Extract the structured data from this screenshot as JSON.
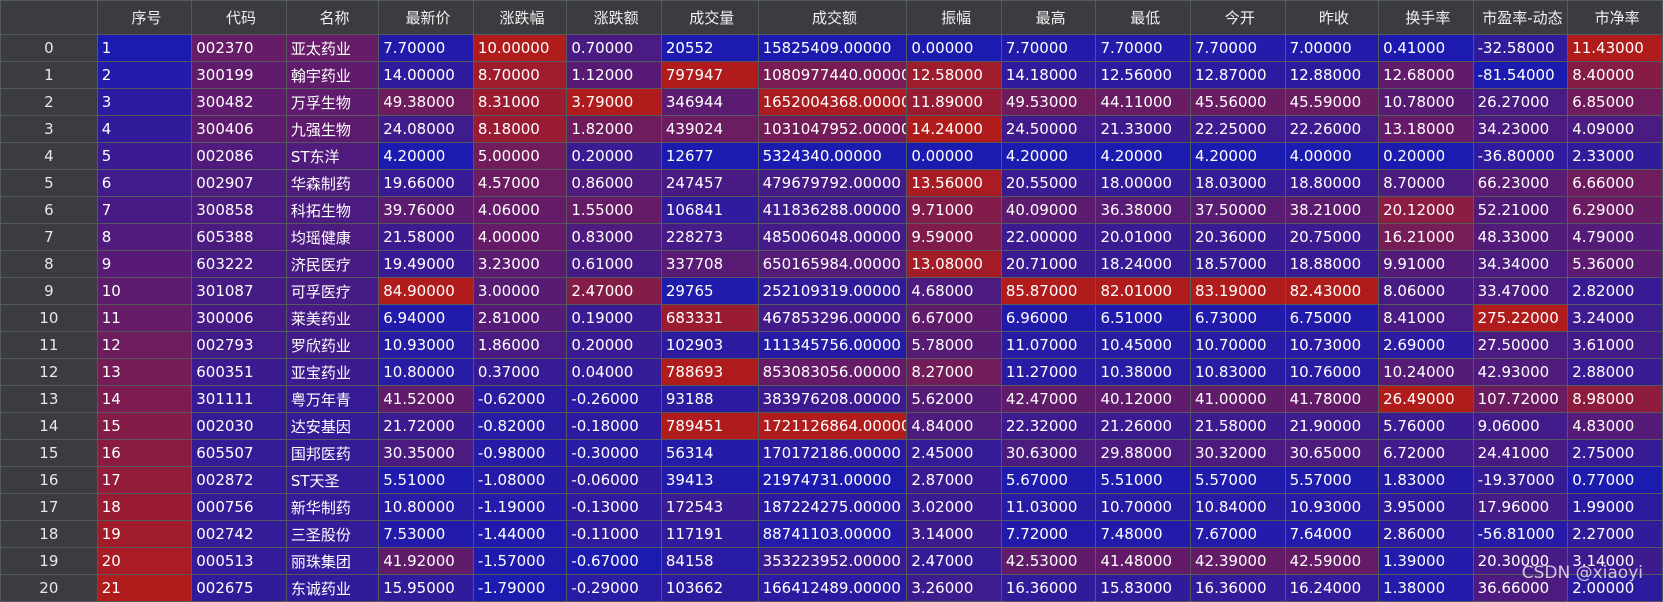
{
  "columns": [
    "",
    "序号",
    "代码",
    "名称",
    "最新价",
    "涨跌幅",
    "涨跌额",
    "成交量",
    "成交额",
    "振幅",
    "最高",
    "最低",
    "今开",
    "昨收",
    "换手率",
    "市盈率-动态",
    "市净率"
  ],
  "rows": [
    [
      "0",
      "1",
      "002370",
      "亚太药业",
      "7.70000",
      "10.00000",
      "0.70000",
      "20552",
      "15825409.00000",
      "0.00000",
      "7.70000",
      "7.70000",
      "7.70000",
      "7.00000",
      "0.41000",
      "-32.58000",
      "11.43000"
    ],
    [
      "1",
      "2",
      "300199",
      "翰宇药业",
      "14.00000",
      "8.70000",
      "1.12000",
      "797947",
      "1080977440.00000",
      "12.58000",
      "14.18000",
      "12.56000",
      "12.87000",
      "12.88000",
      "12.68000",
      "-81.54000",
      "8.40000"
    ],
    [
      "2",
      "3",
      "300482",
      "万孚生物",
      "49.38000",
      "8.31000",
      "3.79000",
      "346944",
      "1652004368.00000",
      "11.89000",
      "49.53000",
      "44.11000",
      "45.56000",
      "45.59000",
      "10.78000",
      "26.27000",
      "6.85000"
    ],
    [
      "3",
      "4",
      "300406",
      "九强生物",
      "24.08000",
      "8.18000",
      "1.82000",
      "439024",
      "1031047952.00000",
      "14.24000",
      "24.50000",
      "21.33000",
      "22.25000",
      "22.26000",
      "13.18000",
      "34.23000",
      "4.09000"
    ],
    [
      "4",
      "5",
      "002086",
      "ST东洋",
      "4.20000",
      "5.00000",
      "0.20000",
      "12677",
      "5324340.00000",
      "0.00000",
      "4.20000",
      "4.20000",
      "4.20000",
      "4.00000",
      "0.20000",
      "-36.80000",
      "2.33000"
    ],
    [
      "5",
      "6",
      "002907",
      "华森制药",
      "19.66000",
      "4.57000",
      "0.86000",
      "247457",
      "479679792.00000",
      "13.56000",
      "20.55000",
      "18.00000",
      "18.03000",
      "18.80000",
      "8.70000",
      "66.23000",
      "6.66000"
    ],
    [
      "6",
      "7",
      "300858",
      "科拓生物",
      "39.76000",
      "4.06000",
      "1.55000",
      "106841",
      "411836288.00000",
      "9.71000",
      "40.09000",
      "36.38000",
      "37.50000",
      "38.21000",
      "20.12000",
      "52.21000",
      "6.29000"
    ],
    [
      "7",
      "8",
      "605388",
      "均瑶健康",
      "21.58000",
      "4.00000",
      "0.83000",
      "228273",
      "485006048.00000",
      "9.59000",
      "22.00000",
      "20.01000",
      "20.36000",
      "20.75000",
      "16.21000",
      "48.33000",
      "4.79000"
    ],
    [
      "8",
      "9",
      "603222",
      "济民医疗",
      "19.49000",
      "3.23000",
      "0.61000",
      "337708",
      "650165984.00000",
      "13.08000",
      "20.71000",
      "18.24000",
      "18.57000",
      "18.88000",
      "9.91000",
      "34.34000",
      "5.36000"
    ],
    [
      "9",
      "10",
      "301087",
      "可孚医疗",
      "84.90000",
      "3.00000",
      "2.47000",
      "29765",
      "252109319.00000",
      "4.68000",
      "85.87000",
      "82.01000",
      "83.19000",
      "82.43000",
      "8.06000",
      "33.47000",
      "2.82000"
    ],
    [
      "10",
      "11",
      "300006",
      "莱美药业",
      "6.94000",
      "2.81000",
      "0.19000",
      "683331",
      "467853296.00000",
      "6.67000",
      "6.96000",
      "6.51000",
      "6.73000",
      "6.75000",
      "8.41000",
      "275.22000",
      "3.24000"
    ],
    [
      "11",
      "12",
      "002793",
      "罗欣药业",
      "10.93000",
      "1.86000",
      "0.20000",
      "102903",
      "111345756.00000",
      "5.78000",
      "11.07000",
      "10.45000",
      "10.70000",
      "10.73000",
      "2.69000",
      "27.50000",
      "3.61000"
    ],
    [
      "12",
      "13",
      "600351",
      "亚宝药业",
      "10.80000",
      "0.37000",
      "0.04000",
      "788693",
      "853083056.00000",
      "8.27000",
      "11.27000",
      "10.38000",
      "10.83000",
      "10.76000",
      "10.24000",
      "42.93000",
      "2.88000"
    ],
    [
      "13",
      "14",
      "301111",
      "粤万年青",
      "41.52000",
      "-0.62000",
      "-0.26000",
      "93188",
      "383976208.00000",
      "5.62000",
      "42.47000",
      "40.12000",
      "41.00000",
      "41.78000",
      "26.49000",
      "107.72000",
      "8.98000"
    ],
    [
      "14",
      "15",
      "002030",
      "达安基因",
      "21.72000",
      "-0.82000",
      "-0.18000",
      "789451",
      "1721126864.00000",
      "4.84000",
      "22.32000",
      "21.26000",
      "21.58000",
      "21.90000",
      "5.76000",
      "9.06000",
      "4.83000"
    ],
    [
      "15",
      "16",
      "605507",
      "国邦医药",
      "30.35000",
      "-0.98000",
      "-0.30000",
      "56314",
      "170172186.00000",
      "2.45000",
      "30.63000",
      "29.88000",
      "30.32000",
      "30.65000",
      "6.72000",
      "24.41000",
      "2.75000"
    ],
    [
      "16",
      "17",
      "002872",
      "ST天圣",
      "5.51000",
      "-1.08000",
      "-0.06000",
      "39413",
      "21974731.00000",
      "2.87000",
      "5.67000",
      "5.51000",
      "5.57000",
      "5.57000",
      "1.83000",
      "-19.37000",
      "0.77000"
    ],
    [
      "17",
      "18",
      "000756",
      "新华制药",
      "10.80000",
      "-1.19000",
      "-0.13000",
      "172543",
      "187224275.00000",
      "3.02000",
      "11.03000",
      "10.70000",
      "10.84000",
      "10.93000",
      "3.95000",
      "17.96000",
      "1.99000"
    ],
    [
      "18",
      "19",
      "002742",
      "三圣股份",
      "7.53000",
      "-1.44000",
      "-0.11000",
      "117191",
      "88741103.00000",
      "3.14000",
      "7.72000",
      "7.48000",
      "7.67000",
      "7.64000",
      "2.86000",
      "-56.81000",
      "2.27000"
    ],
    [
      "19",
      "20",
      "000513",
      "丽珠集团",
      "41.92000",
      "-1.57000",
      "-0.67000",
      "84158",
      "353223952.00000",
      "2.47000",
      "42.53000",
      "41.48000",
      "42.39000",
      "42.59000",
      "1.39000",
      "20.30000",
      "3.14000"
    ],
    [
      "20",
      "21",
      "002675",
      "东诚药业",
      "15.95000",
      "-1.79000",
      "-0.29000",
      "103662",
      "166412489.00000",
      "3.26000",
      "16.36000",
      "15.83000",
      "16.36000",
      "16.24000",
      "1.38000",
      "36.66000",
      "2.00000"
    ]
  ],
  "colors": {
    "low": "#1c1bb0",
    "high": "#b01c1c",
    "header_bg": "#3a3c40",
    "grid": "#55585d"
  },
  "watermark": "CSDN @xiaoyi"
}
